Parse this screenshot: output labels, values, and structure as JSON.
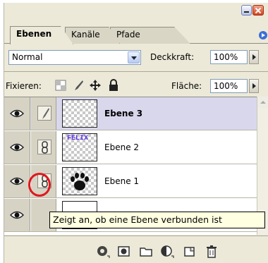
{
  "tabs": [
    {
      "label": "Ebenen",
      "active": true
    },
    {
      "label": "Kanäle",
      "active": false
    },
    {
      "label": "Pfade",
      "active": false
    }
  ],
  "blend": {
    "mode": "Normal",
    "opacity_label": "Deckkraft:",
    "opacity_value": "100%"
  },
  "lock": {
    "label": "Fixieren:",
    "fill_label": "Fläche:",
    "fill_value": "100%",
    "icons": [
      "lock-transparency-icon",
      "lock-image-icon",
      "lock-position-icon",
      "lock-all-icon"
    ]
  },
  "layers": [
    {
      "name": "Ebene 3",
      "selected": true,
      "link_icon": "brush-icon",
      "thumb": "transparent"
    },
    {
      "name": "Ebene 2",
      "selected": false,
      "link_icon": "chain-link-icon",
      "thumb": "text",
      "thumb_text": "FELIX"
    },
    {
      "name": "Ebene 1",
      "selected": false,
      "link_icon": "chain-link-icon",
      "thumb": "paw"
    },
    {
      "name": "",
      "selected": false,
      "link_icon": "",
      "thumb": "white"
    }
  ],
  "tooltip": "Zeigt an, ob eine Ebene verbunden ist",
  "colors": {
    "panel_bg": "#ece9d8",
    "selected_row": "#d9d7ec",
    "highlight": "#e0171e",
    "tooltip_bg": "#ffffe1",
    "felix_text": "#5a2ee6"
  },
  "toolbar_icons": [
    "layer-style-icon",
    "layer-mask-icon",
    "new-group-icon",
    "adjustment-layer-icon",
    "new-layer-icon",
    "trash-icon"
  ]
}
